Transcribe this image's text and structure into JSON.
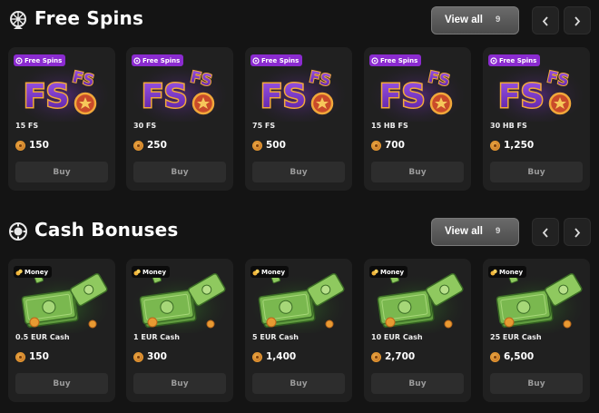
{
  "free_spins": {
    "title": "Free Spins",
    "icon": "wheel-icon",
    "view_all_label": "View all",
    "view_all_count": "9",
    "cards": [
      {
        "badge": "Free Spins",
        "name": "15 FS",
        "price": "150",
        "buy_label": "Buy"
      },
      {
        "badge": "Free Spins",
        "name": "30 FS",
        "price": "250",
        "buy_label": "Buy"
      },
      {
        "badge": "Free Spins",
        "name": "75 FS",
        "price": "500",
        "buy_label": "Buy"
      },
      {
        "badge": "Free Spins",
        "name": "15 HB FS",
        "price": "700",
        "buy_label": "Buy"
      },
      {
        "badge": "Free Spins",
        "name": "30 HB FS",
        "price": "1,250",
        "buy_label": "Buy"
      }
    ]
  },
  "cash_bonuses": {
    "title": "Cash Bonuses",
    "icon": "chip-icon",
    "view_all_label": "View all",
    "view_all_count": "9",
    "cards": [
      {
        "badge": "Money",
        "name": "0.5 EUR Cash",
        "price": "150",
        "buy_label": "Buy"
      },
      {
        "badge": "Money",
        "name": "1 EUR Cash",
        "price": "300",
        "buy_label": "Buy"
      },
      {
        "badge": "Money",
        "name": "5 EUR Cash",
        "price": "1,400",
        "buy_label": "Buy"
      },
      {
        "badge": "Money",
        "name": "10 EUR Cash",
        "price": "2,700",
        "buy_label": "Buy"
      },
      {
        "badge": "Money",
        "name": "25 EUR Cash",
        "price": "6,500",
        "buy_label": "Buy"
      }
    ]
  },
  "colors": {
    "background": "#141414",
    "card": "#202020",
    "fs_badge": "#8b2bd0",
    "fs_gold": "#f1a83a",
    "fs_purple": "#6b2db0",
    "cash_green": "#6fb04a",
    "coin": "#e89a32"
  }
}
